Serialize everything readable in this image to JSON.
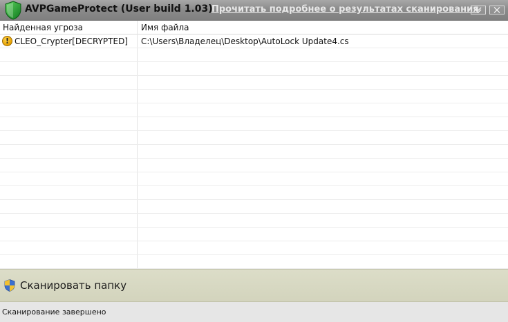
{
  "window": {
    "title": "AVPGameProtect (User build 1.03)",
    "scan_results_link": "Прочитать подробнее о результатах сканирования",
    "minimize_icon": "chevron-down-icon",
    "close_icon": "close-icon"
  },
  "table": {
    "columns": [
      "Найденная угроза",
      "Имя файла"
    ],
    "rows": [
      {
        "threat": "CLEO_Crypter[DECRYPTED]",
        "file": "C:\\Users\\Владелец\\Desktop\\AutoLock Update4.cs",
        "icon": "warning-icon"
      }
    ]
  },
  "actions": {
    "scan_folder_label": "Сканировать папку",
    "scan_folder_icon": "uac-shield-icon"
  },
  "status": {
    "text": "Сканирование завершено"
  },
  "colors": {
    "titlebar": "#8c8c8c",
    "action_panel": "#d8d9c3",
    "warning": "#e6a100"
  }
}
